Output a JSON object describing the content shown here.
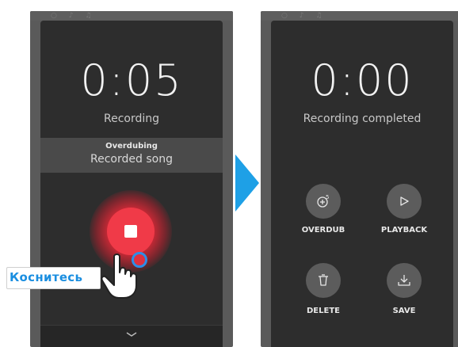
{
  "left_screen": {
    "timer": "0:05",
    "status": "Recording",
    "overdub_title": "Overdubing",
    "song_name": "Recorded song",
    "icons": [
      "stop-icon",
      "chevron-down-icon"
    ]
  },
  "right_screen": {
    "timer": "0:00",
    "status": "Recording completed",
    "actions": [
      {
        "label": "OVERDUB",
        "icon": "overdub-icon"
      },
      {
        "label": "PLAYBACK",
        "icon": "play-icon"
      },
      {
        "label": "DELETE",
        "icon": "trash-icon"
      },
      {
        "label": "SAVE",
        "icon": "save-download-icon"
      }
    ]
  },
  "callout": {
    "text": "Коснитесь"
  },
  "colors": {
    "screen_bg": "#2d2d2d",
    "record_red": "#f03a48",
    "callout_blue": "#1a8ee0",
    "arrow_blue": "#1ea0e6"
  }
}
